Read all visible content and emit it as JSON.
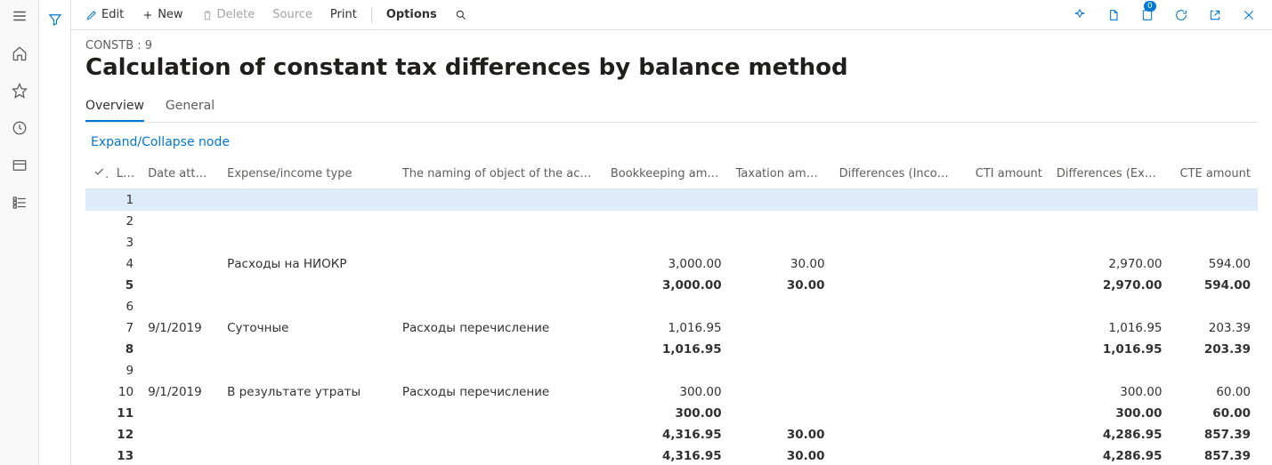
{
  "toolbar": {
    "edit": "Edit",
    "new": "New",
    "delete": "Delete",
    "source": "Source",
    "print": "Print",
    "options": "Options",
    "badge_count": "0"
  },
  "header": {
    "breadcrumb": "CONSTB : 9",
    "title": "Calculation of constant tax differences by balance method"
  },
  "tabs": {
    "overview": "Overview",
    "general": "General"
  },
  "actions": {
    "expand_collapse": "Expand/Collapse node"
  },
  "columns": {
    "line": "Li...",
    "date": "Date attached",
    "type": "Expense/income type",
    "naming": "The naming of object of the account",
    "bookkeeping": "Bookkeeping amount",
    "taxation": "Taxation amount",
    "diff_income": "Differences (Income)",
    "cti": "CTI amount",
    "diff_expense": "Differences (Expense)",
    "cte": "CTE amount"
  },
  "rows": [
    {
      "line": "1",
      "date": "",
      "type": "",
      "naming": "",
      "bk": "",
      "tax": "",
      "din": "",
      "cti": "",
      "dex": "",
      "cte": "",
      "selected": true
    },
    {
      "line": "2",
      "date": "",
      "type": "",
      "naming": "",
      "bk": "",
      "tax": "",
      "din": "",
      "cti": "",
      "dex": "",
      "cte": ""
    },
    {
      "line": "3",
      "date": "",
      "type": "",
      "naming": "",
      "bk": "",
      "tax": "",
      "din": "",
      "cti": "",
      "dex": "",
      "cte": ""
    },
    {
      "line": "4",
      "date": "",
      "type": "Расходы на НИОКР",
      "naming": "",
      "bk": "3,000.00",
      "tax": "30.00",
      "din": "",
      "cti": "",
      "dex": "2,970.00",
      "cte": "594.00"
    },
    {
      "line": "5",
      "date": "",
      "type": "",
      "naming": "",
      "bk": "3,000.00",
      "tax": "30.00",
      "din": "",
      "cti": "",
      "dex": "2,970.00",
      "cte": "594.00",
      "bold": true
    },
    {
      "line": "6",
      "date": "",
      "type": "",
      "naming": "",
      "bk": "",
      "tax": "",
      "din": "",
      "cti": "",
      "dex": "",
      "cte": ""
    },
    {
      "line": "7",
      "date": "9/1/2019",
      "type": "Суточные",
      "naming": "Расходы перечисление",
      "bk": "1,016.95",
      "tax": "",
      "din": "",
      "cti": "",
      "dex": "1,016.95",
      "cte": "203.39"
    },
    {
      "line": "8",
      "date": "",
      "type": "",
      "naming": "",
      "bk": "1,016.95",
      "tax": "",
      "din": "",
      "cti": "",
      "dex": "1,016.95",
      "cte": "203.39",
      "bold": true
    },
    {
      "line": "9",
      "date": "",
      "type": "",
      "naming": "",
      "bk": "",
      "tax": "",
      "din": "",
      "cti": "",
      "dex": "",
      "cte": ""
    },
    {
      "line": "10",
      "date": "9/1/2019",
      "type": "В результате утраты",
      "naming": "Расходы перечисление",
      "bk": "300.00",
      "tax": "",
      "din": "",
      "cti": "",
      "dex": "300.00",
      "cte": "60.00"
    },
    {
      "line": "11",
      "date": "",
      "type": "",
      "naming": "",
      "bk": "300.00",
      "tax": "",
      "din": "",
      "cti": "",
      "dex": "300.00",
      "cte": "60.00",
      "bold": true
    },
    {
      "line": "12",
      "date": "",
      "type": "",
      "naming": "",
      "bk": "4,316.95",
      "tax": "30.00",
      "din": "",
      "cti": "",
      "dex": "4,286.95",
      "cte": "857.39",
      "bold": true
    },
    {
      "line": "13",
      "date": "",
      "type": "",
      "naming": "",
      "bk": "4,316.95",
      "tax": "30.00",
      "din": "",
      "cti": "",
      "dex": "4,286.95",
      "cte": "857.39",
      "bold": true
    }
  ]
}
